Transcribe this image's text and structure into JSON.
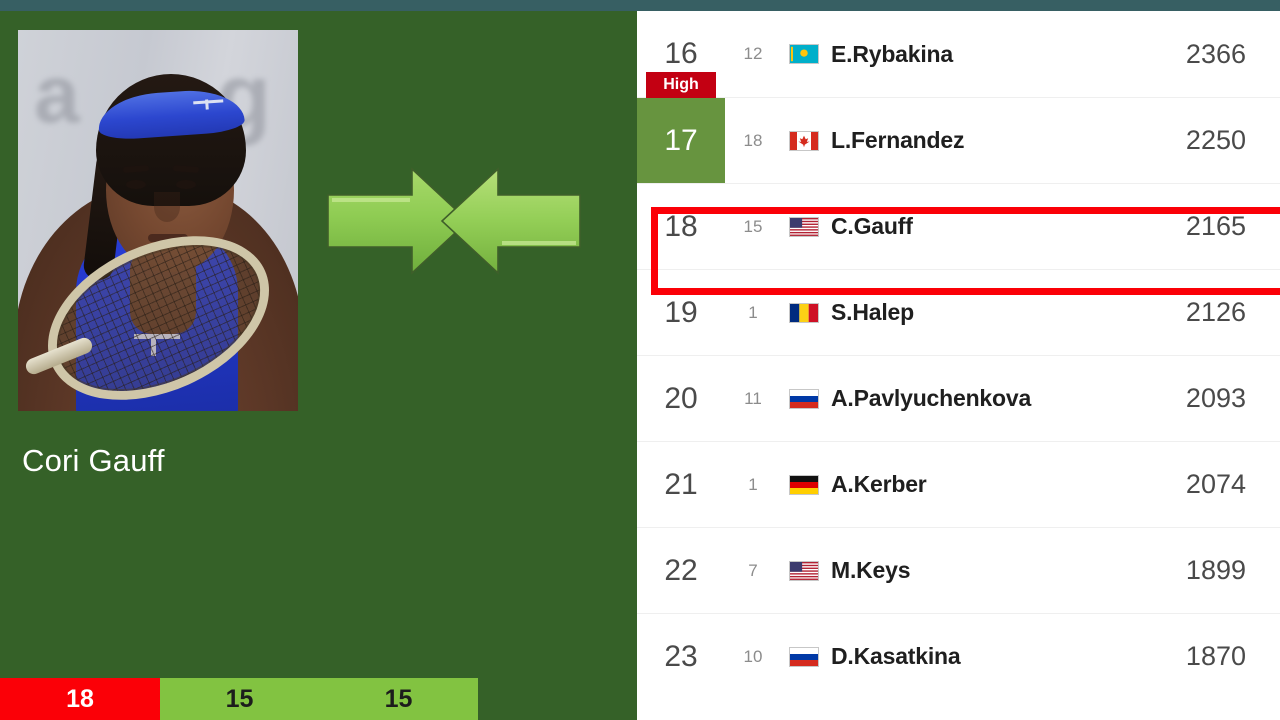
{
  "colors": {
    "top_strip": "#375f63",
    "panel_green": "#356128",
    "accent_red": "#fb0007",
    "badge_red": "#c30012",
    "rank_green": "#67943f",
    "bar_green": "#82c341"
  },
  "player": {
    "name": "Cori Gauff",
    "photo_alt": "Cori Gauff tennis action photo"
  },
  "arrows": {
    "icon_left": "arrow-right-icon",
    "icon_right": "arrow-left-icon"
  },
  "stat_bar": {
    "rank": "18",
    "value_a": "15",
    "value_b": "15"
  },
  "ranking": {
    "high_badge": "High",
    "rows": [
      {
        "rank": "16",
        "move": "12",
        "flag": "kazakhstan-flag",
        "name": "E.Rybakina",
        "points": "2366",
        "highlighted": false,
        "green": false,
        "badge": false
      },
      {
        "rank": "17",
        "move": "18",
        "flag": "canada-flag",
        "name": "L.Fernandez",
        "points": "2250",
        "highlighted": false,
        "green": true,
        "badge": true
      },
      {
        "rank": "18",
        "move": "15",
        "flag": "usa-flag",
        "name": "C.Gauff",
        "points": "2165",
        "highlighted": true,
        "green": false,
        "badge": false
      },
      {
        "rank": "19",
        "move": "1",
        "flag": "romania-flag",
        "name": "S.Halep",
        "points": "2126",
        "highlighted": false,
        "green": false,
        "badge": false
      },
      {
        "rank": "20",
        "move": "11",
        "flag": "russia-flag",
        "name": "A.Pavlyuchenkova",
        "points": "2093",
        "highlighted": false,
        "green": false,
        "badge": false
      },
      {
        "rank": "21",
        "move": "1",
        "flag": "germany-flag",
        "name": "A.Kerber",
        "points": "2074",
        "highlighted": false,
        "green": false,
        "badge": false
      },
      {
        "rank": "22",
        "move": "7",
        "flag": "usa-flag",
        "name": "M.Keys",
        "points": "1899",
        "highlighted": false,
        "green": false,
        "badge": false
      },
      {
        "rank": "23",
        "move": "10",
        "flag": "russia-flag",
        "name": "D.Kasatkina",
        "points": "1870",
        "highlighted": false,
        "green": false,
        "badge": false
      }
    ]
  }
}
